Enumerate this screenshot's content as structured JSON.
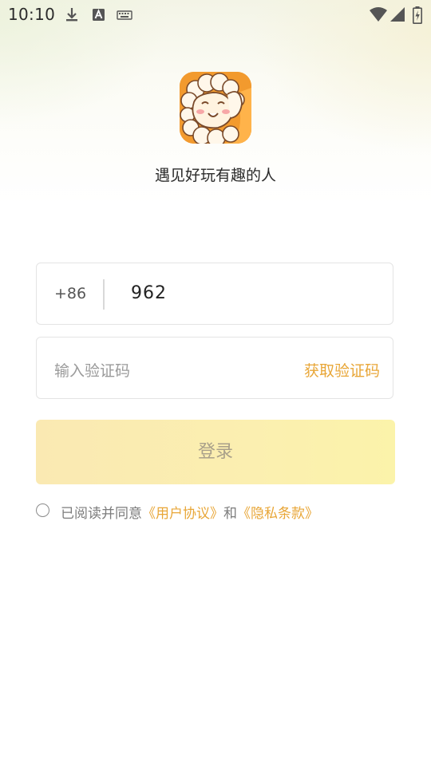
{
  "status_bar": {
    "time": "10:10",
    "icons": [
      "download-icon",
      "font-a-icon",
      "keyboard-icon",
      "wifi-icon",
      "signal-icon",
      "battery-charging-icon"
    ]
  },
  "app": {
    "logo_icon": "sheep-mascot-logo",
    "tagline": "遇见好玩有趣的人"
  },
  "phone": {
    "country_code": "+86",
    "value": "962"
  },
  "code": {
    "placeholder": "输入验证码",
    "get_code_label": "获取验证码"
  },
  "login": {
    "label": "登录"
  },
  "agreement": {
    "prefix": "已阅读并同意",
    "user_agreement": "《用户协议》",
    "and": "和",
    "privacy": "《隐私条款》",
    "checked": false
  },
  "colors": {
    "accent": "#e8a637",
    "logo_bg": "#f29a2e",
    "button_bg": "#fbeeb0"
  }
}
